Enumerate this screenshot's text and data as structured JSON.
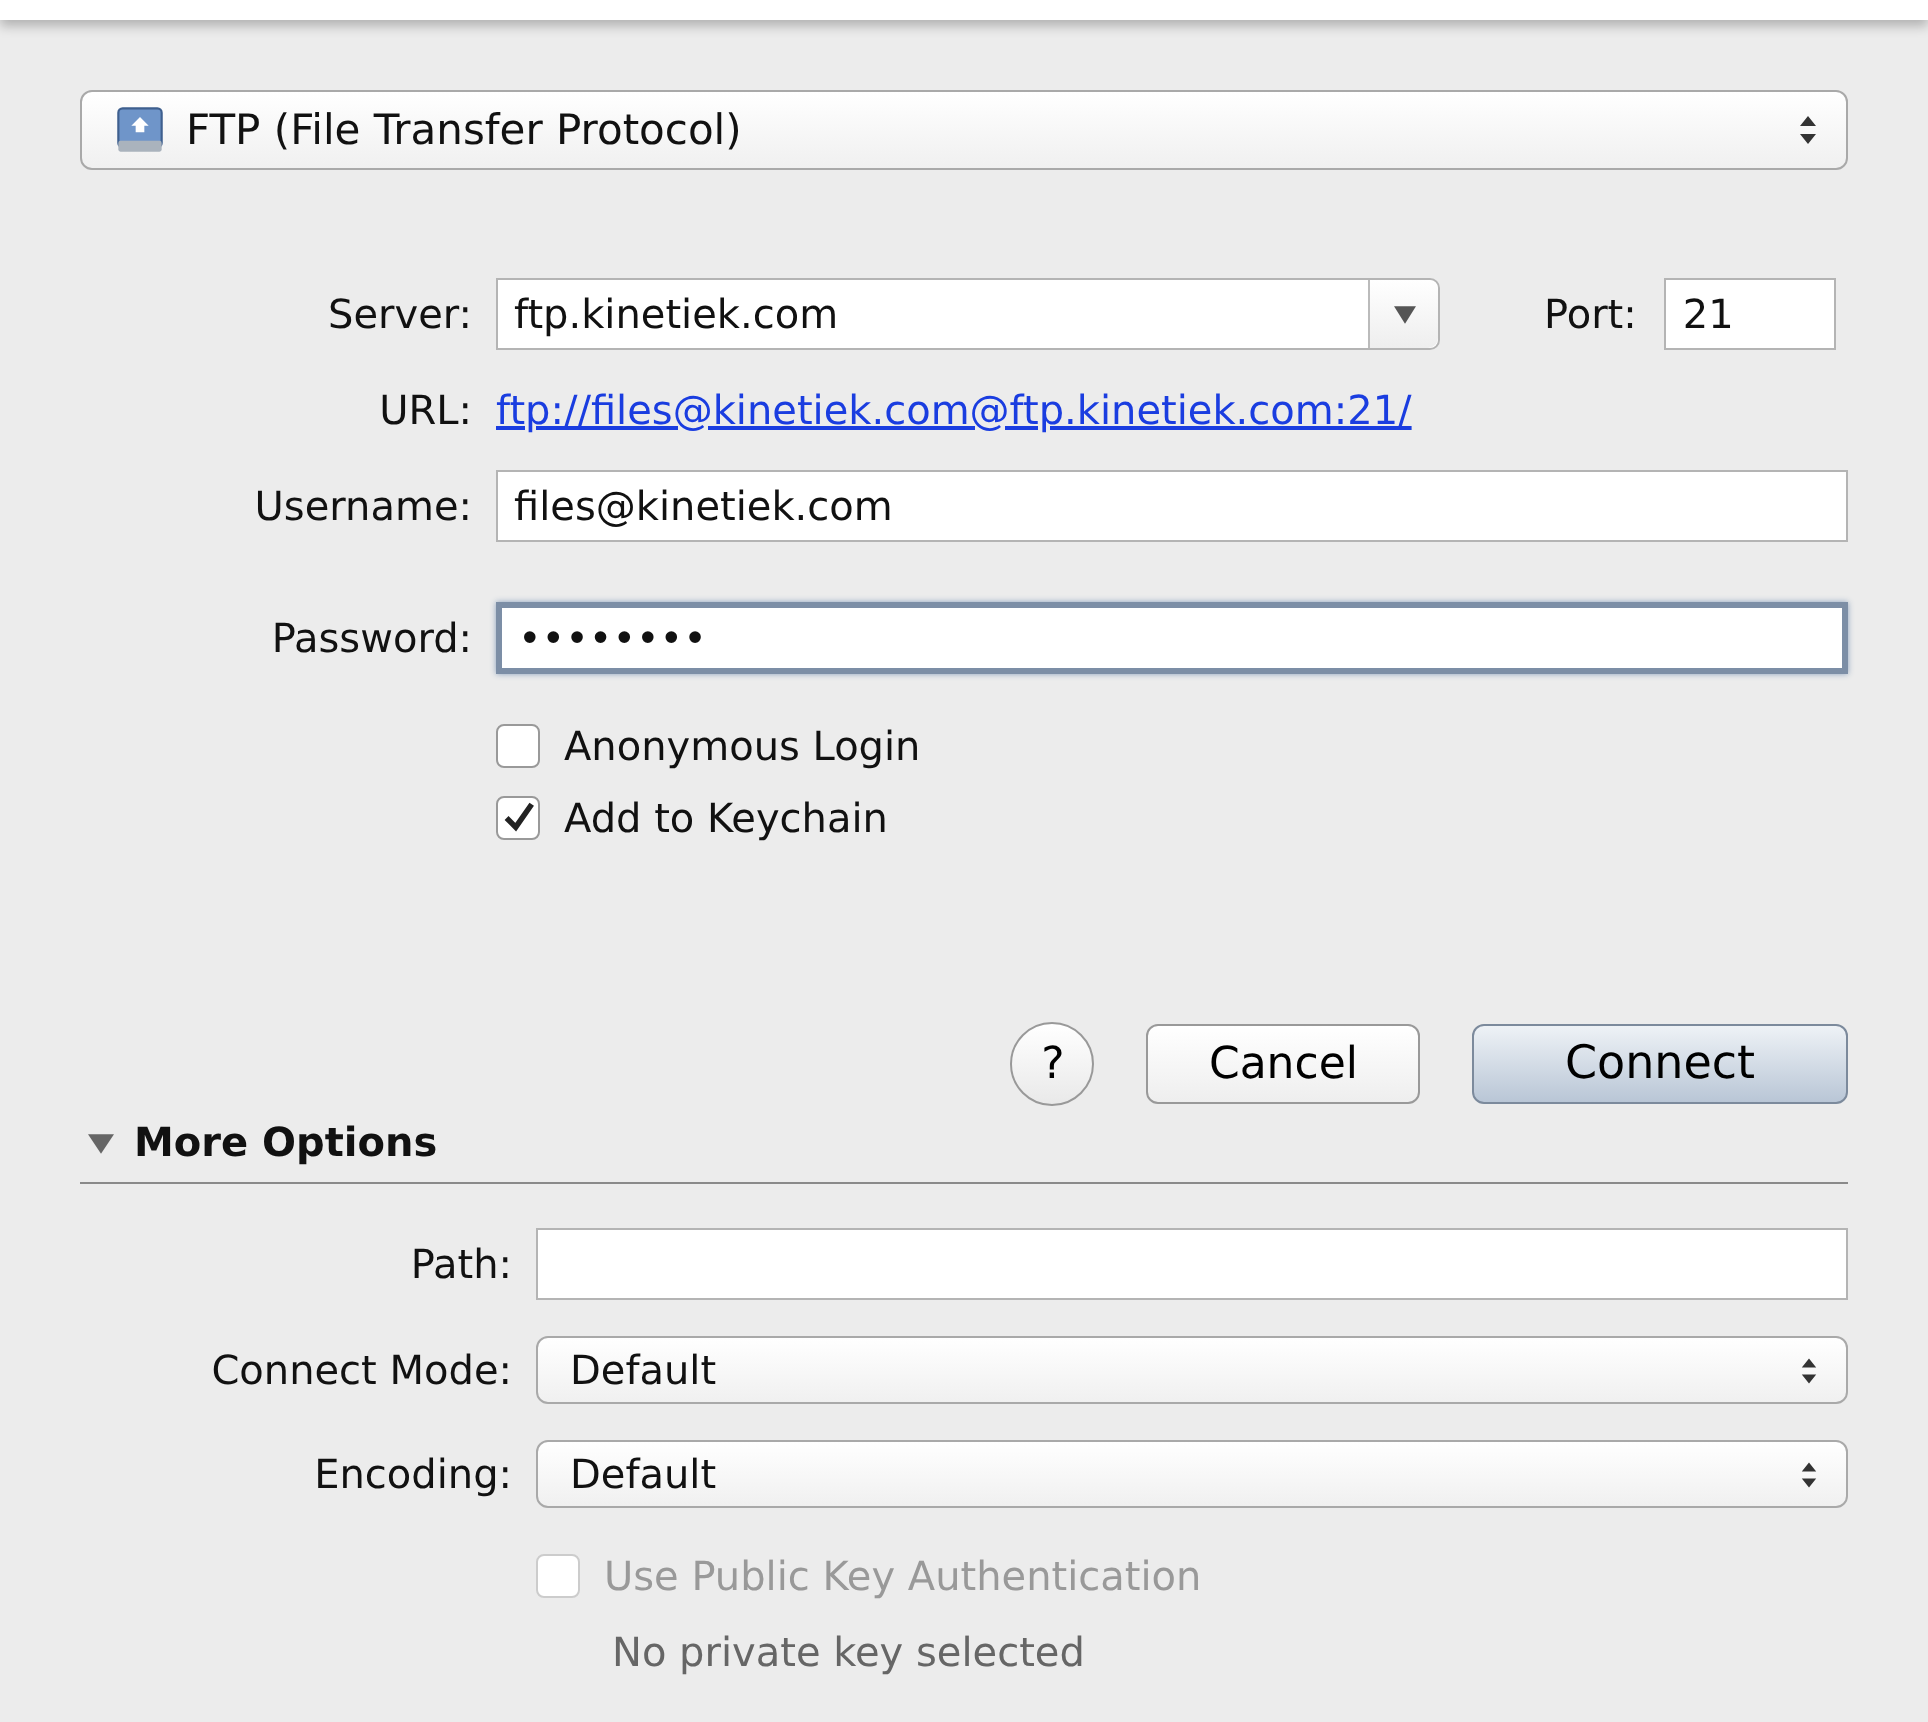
{
  "protocol_popup": {
    "value": "FTP (File Transfer Protocol)"
  },
  "server": {
    "label": "Server:",
    "value": "ftp.kinetiek.com"
  },
  "port": {
    "label": "Port:",
    "value": "21"
  },
  "url": {
    "label": "URL:",
    "link": "ftp://files@kinetiek.com@ftp.kinetiek.com:21/"
  },
  "username": {
    "label": "Username:",
    "value": "files@kinetiek.com"
  },
  "password": {
    "label": "Password:",
    "value": "••••••••",
    "focused": true
  },
  "options": [
    {
      "label": "Anonymous Login",
      "checked": false
    },
    {
      "label": "Add to Keychain",
      "checked": true
    }
  ],
  "buttons": [
    {
      "kind": "help",
      "label": "?"
    },
    {
      "kind": "plain",
      "label": "Cancel"
    },
    {
      "kind": "default",
      "label": "Connect"
    }
  ],
  "more_options": {
    "label": "More Options",
    "expanded": true,
    "fields": [
      {
        "kind": "text",
        "label": "Path:"
      },
      {
        "kind": "popup",
        "label": "Connect Mode:",
        "value": "Default"
      },
      {
        "kind": "popup",
        "label": "Encoding:",
        "value": "Default"
      }
    ],
    "public_key": {
      "label": "Use Public Key Authentication",
      "checked": false,
      "disabled": true
    },
    "key_status": "No private key selected"
  }
}
